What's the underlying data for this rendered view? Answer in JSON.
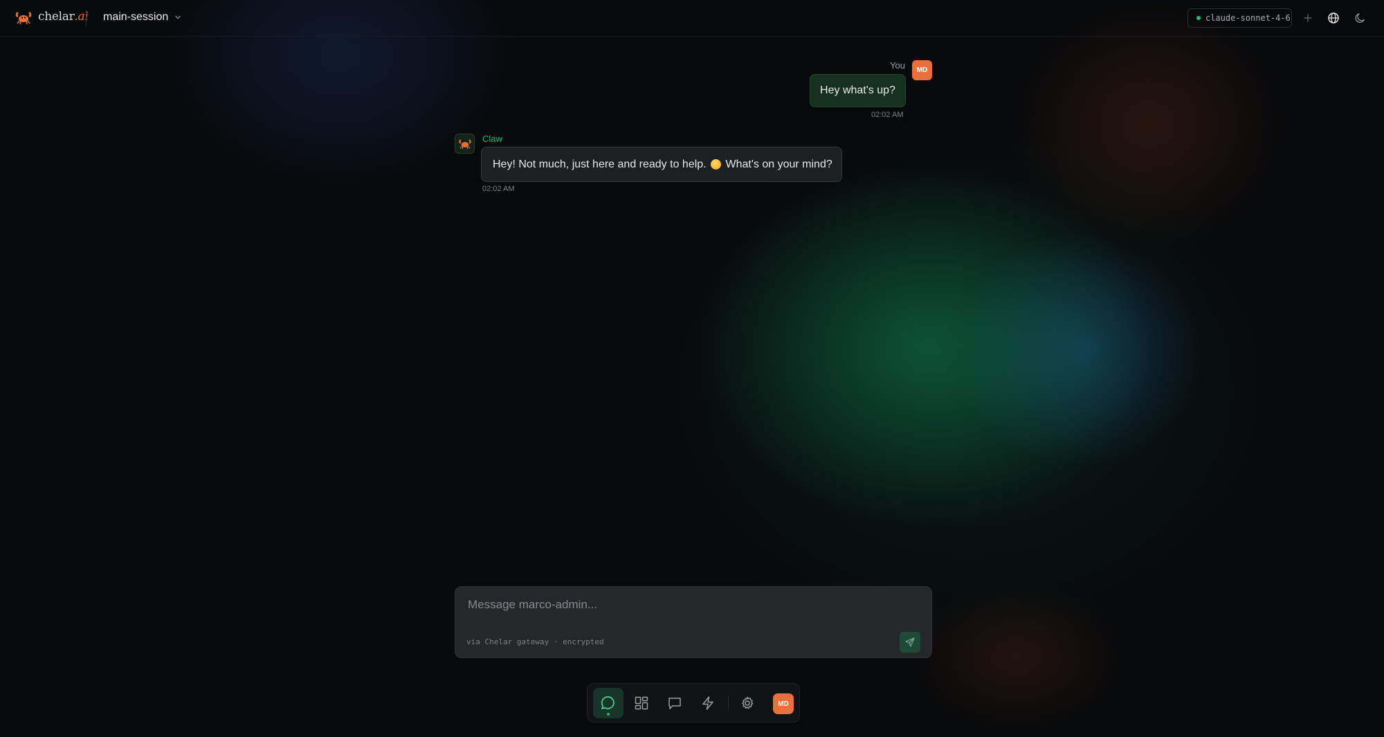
{
  "header": {
    "brand_name": "chelar",
    "brand_suffix": ".ai",
    "session_name": "main-session",
    "model": "claude-sonnet-4-6",
    "icons": [
      "crab-logo-icon",
      "chevron-down-icon",
      "plus-icon",
      "globe-icon",
      "moon-icon"
    ]
  },
  "chat": {
    "user_label": "You",
    "user_initials": "MD",
    "user_message": "Hey what's up?",
    "user_time": "02:02 AM",
    "bot_name": "Claw",
    "bot_message_part1": "Hey! Not much, just here and ready to help.",
    "bot_message_part2": "What's on your mind?",
    "bot_emoji": "smiling-face",
    "bot_time": "02:02 AM"
  },
  "composer": {
    "placeholder": "Message marco-admin...",
    "note": "via Chelar gateway · encrypted"
  },
  "dock": {
    "items": [
      "chat-icon",
      "dashboard-icon",
      "messages-icon",
      "lightning-icon",
      "gear-icon"
    ],
    "active": "chat-icon",
    "avatar_initials": "MD"
  },
  "colors": {
    "accent_orange": "#e8703a",
    "accent_green": "#27b877",
    "background": "#08090b"
  }
}
